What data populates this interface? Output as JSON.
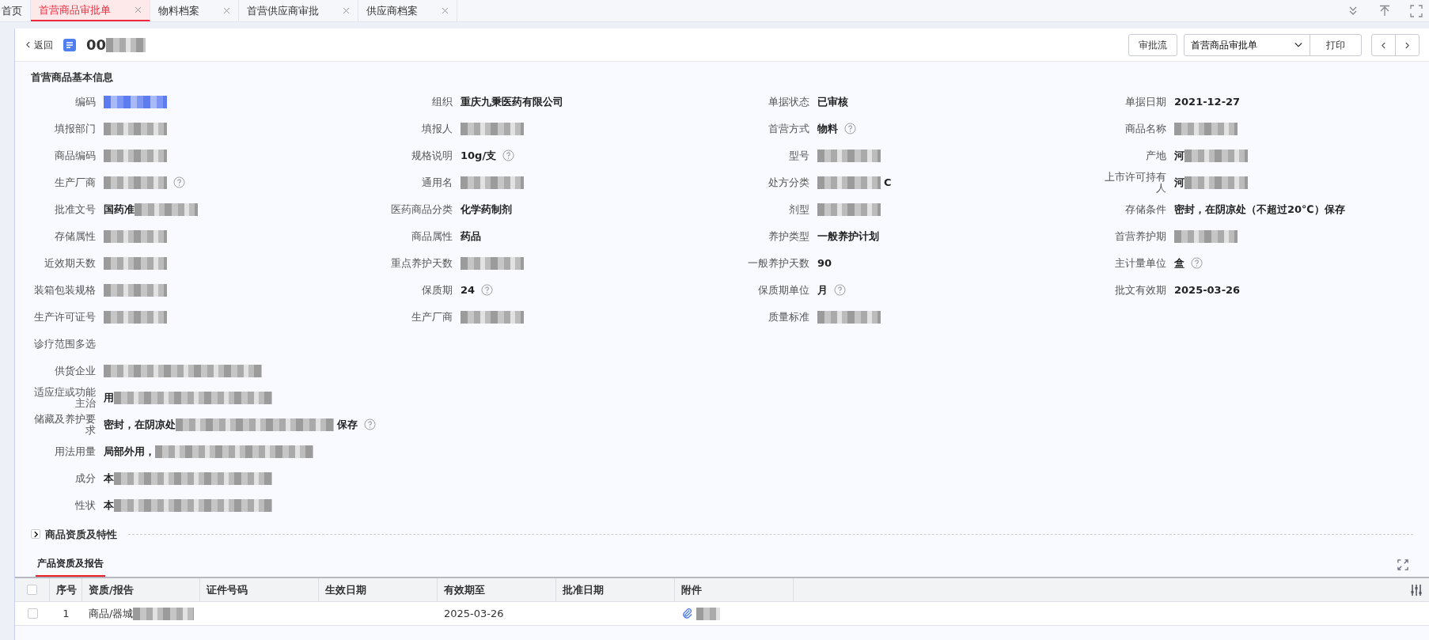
{
  "tabs": [
    {
      "label": "首页",
      "selected": false,
      "closable": false
    },
    {
      "label": "首营商品审批单",
      "selected": true,
      "closable": true
    },
    {
      "label": "物料档案",
      "selected": false,
      "closable": true
    },
    {
      "label": "首营供应商审批",
      "selected": false,
      "closable": true
    },
    {
      "label": "供应商档案",
      "selected": false,
      "closable": true
    }
  ],
  "header": {
    "back": "返回",
    "code": "00",
    "code_redacted": true,
    "buttons": {
      "flow": "审批流",
      "template": "首营商品审批单",
      "print": "打印"
    }
  },
  "basic_info": {
    "title": "首营商品基本信息",
    "fields": [
      {
        "label": "编码",
        "redacted": true,
        "link": true,
        "help": false
      },
      {
        "label": "组织",
        "value": "重庆九秉医药有限公司",
        "help": false
      },
      {
        "label": "单据状态",
        "value": "已审核",
        "help": false
      },
      {
        "label": "单据日期",
        "value": "2021-12-27",
        "help": false
      },
      {
        "label": "填报部门",
        "redacted": true,
        "help": false
      },
      {
        "label": "填报人",
        "redacted": true,
        "help": false
      },
      {
        "label": "首营方式",
        "value": "物料",
        "help": true
      },
      {
        "label": "商品名称",
        "redacted": true,
        "help": false
      },
      {
        "label": "商品编码",
        "redacted": true,
        "help": false
      },
      {
        "label": "规格说明",
        "value": "10g/支",
        "help": true
      },
      {
        "label": "型号",
        "redacted": true,
        "help": false
      },
      {
        "label": "产地",
        "value": "河",
        "redacted": true,
        "help": false
      },
      {
        "label": "生产厂商",
        "redacted": true,
        "help": true
      },
      {
        "label": "通用名",
        "redacted": true,
        "help": false
      },
      {
        "label": "处方分类",
        "redacted": true,
        "value_after": "C",
        "help": false
      },
      {
        "label": "上市许可持有人",
        "value": "河",
        "redacted": true,
        "help": false
      },
      {
        "label": "批准文号",
        "value": "国药准",
        "redacted": true,
        "help": false
      },
      {
        "label": "医药商品分类",
        "value": "化学药制剂",
        "help": false
      },
      {
        "label": "剂型",
        "redacted": true,
        "help": false
      },
      {
        "label": "存储条件",
        "value": "密封，在阴凉处（不超过20℃）保存",
        "help": false
      },
      {
        "label": "存储属性",
        "redacted": true,
        "help": false
      },
      {
        "label": "商品属性",
        "value": "药品",
        "help": false
      },
      {
        "label": "养护类型",
        "value": "一般养护计划",
        "help": false
      },
      {
        "label": "首营养护期",
        "redacted": true,
        "help": false
      },
      {
        "label": "近效期天数",
        "redacted": true,
        "help": false
      },
      {
        "label": "重点养护天数",
        "redacted": true,
        "help": false
      },
      {
        "label": "一般养护天数",
        "value": "90",
        "help": false
      },
      {
        "label": "主计量单位",
        "value": "盒",
        "help": true
      },
      {
        "label": "装箱包装规格",
        "redacted": true,
        "help": false
      },
      {
        "label": "保质期",
        "value": "24",
        "help": true
      },
      {
        "label": "保质期单位",
        "value": "月",
        "help": true
      },
      {
        "label": "批文有效期",
        "value": "2025-03-26",
        "help": false
      },
      {
        "label": "生产许可证号",
        "redacted": true,
        "help": false
      },
      {
        "label": "生产厂商",
        "redacted": true,
        "help": false
      },
      {
        "label": "质量标准",
        "redacted": true,
        "help": false
      }
    ],
    "wide_fields": [
      {
        "label": "诊疗范围多选",
        "help": false
      },
      {
        "label": "供货企业",
        "redacted": true,
        "help": false
      },
      {
        "label": "适应症或功能主治",
        "value": "用",
        "redacted": true,
        "help": false
      },
      {
        "label": "储藏及养护要求",
        "value": "密封，在阴凉处",
        "redacted": true,
        "value_after": "保存",
        "help": true
      },
      {
        "label": "用法用量",
        "value": "局部外用，",
        "redacted": true,
        "help": false
      },
      {
        "label": "成分",
        "value": "本",
        "redacted": true,
        "help": false
      },
      {
        "label": "性状",
        "value": "本",
        "redacted": true,
        "help": false
      }
    ]
  },
  "collapsed_section": {
    "title": "商品资质及特性",
    "expanded": false
  },
  "sub_tabs": [
    {
      "label": "产品资质及报告",
      "selected": true
    }
  ],
  "table": {
    "all_checked": false,
    "columns": [
      "序号",
      "资质/报告",
      "证件号码",
      "生效日期",
      "有效期至",
      "批准日期",
      "附件"
    ],
    "rows": [
      {
        "checked": false,
        "index": "1",
        "report": "商品/器城",
        "report_redacted": true,
        "valid_until": "2025-03-26",
        "attachment": true,
        "attachment_redacted": true
      }
    ]
  }
}
